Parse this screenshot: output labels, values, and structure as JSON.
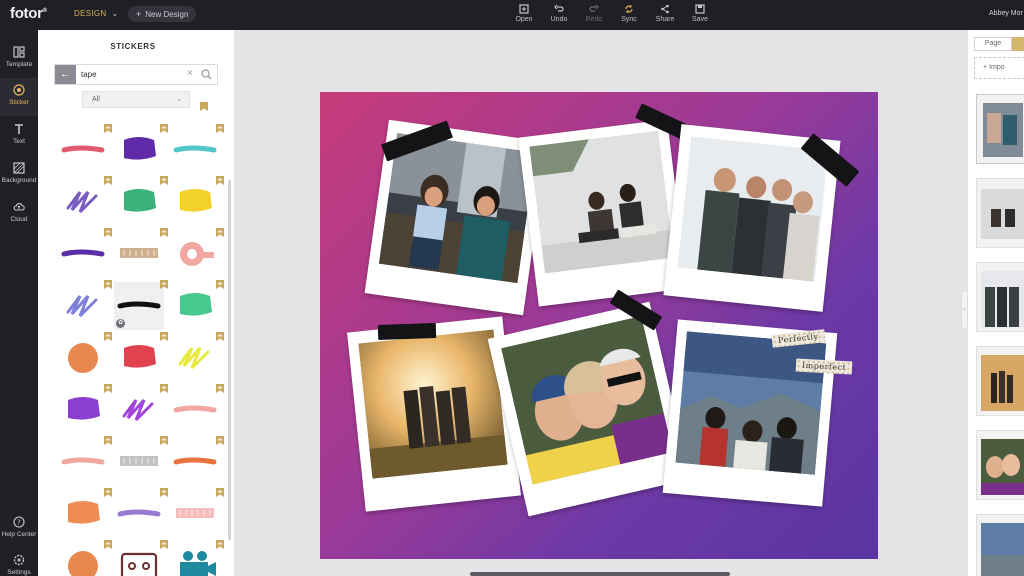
{
  "app": {
    "logo": "fotor",
    "logo_mark": "®",
    "design_menu": "DESIGN",
    "new_design": "New Design",
    "user_name": "Abbey Mor"
  },
  "toolbar": [
    {
      "label": "Open",
      "icon": "open-icon",
      "enabled": true
    },
    {
      "label": "Undo",
      "icon": "undo-icon",
      "enabled": true
    },
    {
      "label": "Redo",
      "icon": "redo-icon",
      "enabled": false
    },
    {
      "label": "Sync",
      "icon": "sync-icon",
      "enabled": true
    },
    {
      "label": "Share",
      "icon": "share-icon",
      "enabled": true
    },
    {
      "label": "Save",
      "icon": "save-icon",
      "enabled": true
    }
  ],
  "leftnav": {
    "items": [
      {
        "label": "Template",
        "icon": "template-icon",
        "active": false
      },
      {
        "label": "Sticker",
        "icon": "sticker-icon",
        "active": true
      },
      {
        "label": "Text",
        "icon": "text-icon",
        "active": false
      },
      {
        "label": "Background",
        "icon": "background-icon",
        "active": false
      },
      {
        "label": "Cloud",
        "icon": "cloud-icon",
        "active": false
      }
    ],
    "bottom": [
      {
        "label": "Help Center",
        "icon": "help-icon"
      },
      {
        "label": "Settings",
        "icon": "settings-icon"
      }
    ]
  },
  "stickers": {
    "title": "STICKERS",
    "search_value": "tape",
    "filter_value": "All",
    "items": [
      {
        "shape": "stroke",
        "color": "#e05a6b"
      },
      {
        "shape": "blob",
        "color": "#5e2aa8"
      },
      {
        "shape": "stroke",
        "color": "#52c6c8"
      },
      {
        "shape": "scribble",
        "color": "#7a5cc0"
      },
      {
        "shape": "blob",
        "color": "#3bb27a"
      },
      {
        "shape": "blob",
        "color": "#f2d22a"
      },
      {
        "shape": "stroke",
        "color": "#5a2ea6"
      },
      {
        "shape": "washi",
        "color": "#c8a27a"
      },
      {
        "shape": "roll",
        "color": "#f0a8a0"
      },
      {
        "shape": "scribble",
        "color": "#7d7fd8"
      },
      {
        "shape": "stroke",
        "color": "#111111"
      },
      {
        "shape": "blob",
        "color": "#46c98f"
      },
      {
        "shape": "circle",
        "color": "#e8874f"
      },
      {
        "shape": "blob",
        "color": "#e0434f"
      },
      {
        "shape": "scribble",
        "color": "#e9ea3e"
      },
      {
        "shape": "blob",
        "color": "#8b3ed2"
      },
      {
        "shape": "scribble",
        "color": "#a146d8"
      },
      {
        "shape": "stroke",
        "color": "#f1a7a0"
      },
      {
        "shape": "stroke",
        "color": "#f0a7a0"
      },
      {
        "shape": "washi",
        "color": "#b9b9b9"
      },
      {
        "shape": "stroke",
        "color": "#e8743d"
      },
      {
        "shape": "blob",
        "color": "#ef8c54"
      },
      {
        "shape": "stroke",
        "color": "#9a7ad0"
      },
      {
        "shape": "washi",
        "color": "#f4b0b0"
      },
      {
        "shape": "circle",
        "color": "#e8884f"
      },
      {
        "shape": "cassette",
        "color": "#6b2f2f"
      },
      {
        "shape": "camera",
        "color": "#1e8aa0"
      }
    ]
  },
  "canvas": {
    "background": [
      "#c73b7a",
      "#5a35a0"
    ],
    "tags": [
      "Perfectly",
      "Imperfect"
    ]
  },
  "right_panel": {
    "tab_page": "Page",
    "import_label": "Impo"
  }
}
